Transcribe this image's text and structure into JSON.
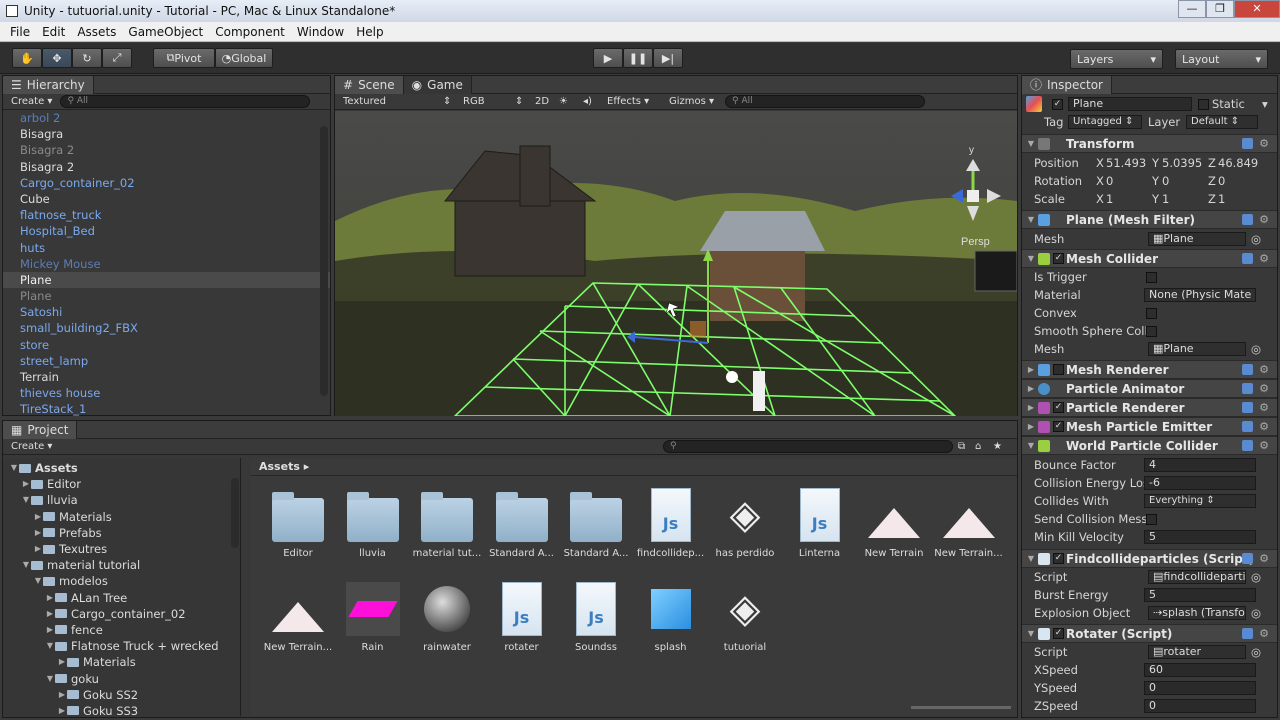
{
  "window": {
    "title": "Unity - tutuorial.unity - Tutorial - PC, Mac & Linux Standalone*",
    "min": "—",
    "max": "❐",
    "close": "✕"
  },
  "menu": [
    "File",
    "Edit",
    "Assets",
    "GameObject",
    "Component",
    "Window",
    "Help"
  ],
  "toolbar": {
    "pivot": "Pivot",
    "global": "Global",
    "layers": "Layers",
    "layout": "Layout"
  },
  "hierarchy": {
    "tab": "Hierarchy",
    "create": "Create",
    "search": "All",
    "items": [
      {
        "label": "arbol 2",
        "style": "dimblue"
      },
      {
        "label": "Bisagra",
        "style": "normal"
      },
      {
        "label": "Bisagra 2",
        "style": "dim"
      },
      {
        "label": "Bisagra 2",
        "style": "normal"
      },
      {
        "label": "Cargo_container_02",
        "style": "prefab"
      },
      {
        "label": "Cube",
        "style": "normal"
      },
      {
        "label": "flatnose_truck",
        "style": "prefab"
      },
      {
        "label": "Hospital_Bed",
        "style": "prefab"
      },
      {
        "label": "huts",
        "style": "prefab"
      },
      {
        "label": "Mickey Mouse",
        "style": "dimblue"
      },
      {
        "label": "Plane",
        "style": "sel"
      },
      {
        "label": "Plane",
        "style": "dim"
      },
      {
        "label": "Satoshi",
        "style": "prefab"
      },
      {
        "label": "small_building2_FBX",
        "style": "prefab"
      },
      {
        "label": "store",
        "style": "prefab"
      },
      {
        "label": "street_lamp",
        "style": "prefab"
      },
      {
        "label": "Terrain",
        "style": "normal"
      },
      {
        "label": "thieves house",
        "style": "prefab"
      },
      {
        "label": "TireStack_1",
        "style": "prefab"
      }
    ]
  },
  "scene": {
    "tab_scene": "Scene",
    "tab_game": "Game",
    "shading": "Textured",
    "render": "RGB",
    "mode2d": "2D",
    "effects": "Effects",
    "gizmos": "Gizmos",
    "search": "All",
    "persp": "Persp",
    "axis_y": "y"
  },
  "project": {
    "tab": "Project",
    "create": "Create",
    "breadcrumb": "Assets",
    "tree": [
      {
        "label": "Assets",
        "depth": 0,
        "open": true,
        "bold": true
      },
      {
        "label": "Editor",
        "depth": 1,
        "open": false
      },
      {
        "label": "lluvia",
        "depth": 1,
        "open": true
      },
      {
        "label": "Materials",
        "depth": 2,
        "open": false
      },
      {
        "label": "Prefabs",
        "depth": 2,
        "open": false
      },
      {
        "label": "Texutres",
        "depth": 2,
        "open": false
      },
      {
        "label": "material tutorial",
        "depth": 1,
        "open": true
      },
      {
        "label": "modelos",
        "depth": 2,
        "open": true
      },
      {
        "label": "ALan Tree",
        "depth": 3,
        "open": false
      },
      {
        "label": "Cargo_container_02",
        "depth": 3,
        "open": false
      },
      {
        "label": "fence",
        "depth": 3,
        "open": false
      },
      {
        "label": "Flatnose Truck + wrecked",
        "depth": 3,
        "open": true
      },
      {
        "label": "Materials",
        "depth": 4,
        "open": false
      },
      {
        "label": "goku",
        "depth": 3,
        "open": true
      },
      {
        "label": "Goku SS2",
        "depth": 4,
        "open": false
      },
      {
        "label": "Goku SS3",
        "depth": 4,
        "open": false
      }
    ],
    "assets_row1": [
      {
        "label": "Editor",
        "kind": "folder"
      },
      {
        "label": "lluvia",
        "kind": "folder"
      },
      {
        "label": "material tut...",
        "kind": "folder"
      },
      {
        "label": "Standard A...",
        "kind": "folder"
      },
      {
        "label": "Standard A...",
        "kind": "folder"
      },
      {
        "label": "findcollidep...",
        "kind": "js"
      },
      {
        "label": "has perdido",
        "kind": "unity"
      },
      {
        "label": "Linterna",
        "kind": "js"
      },
      {
        "label": "New Terrain",
        "kind": "terrain"
      },
      {
        "label": "New Terrain...",
        "kind": "terrain"
      }
    ],
    "assets_row2": [
      {
        "label": "New Terrain...",
        "kind": "terrain"
      },
      {
        "label": "Rain",
        "kind": "material-pink"
      },
      {
        "label": "rainwater",
        "kind": "sphere"
      },
      {
        "label": "rotater",
        "kind": "js"
      },
      {
        "label": "Soundss",
        "kind": "js"
      },
      {
        "label": "splash",
        "kind": "cube"
      },
      {
        "label": "tutuorial",
        "kind": "unity"
      }
    ]
  },
  "inspector": {
    "tab": "Inspector",
    "object_name": "Plane",
    "static": "Static",
    "tag_label": "Tag",
    "tag_value": "Untagged",
    "layer_label": "Layer",
    "layer_value": "Default",
    "transform": {
      "title": "Transform",
      "position": {
        "label": "Position",
        "x": "51.493",
        "y": "5.0395",
        "z": "46.849"
      },
      "rotation": {
        "label": "Rotation",
        "x": "0",
        "y": "0",
        "z": "0"
      },
      "scale": {
        "label": "Scale",
        "x": "1",
        "y": "1",
        "z": "1"
      }
    },
    "mesh_filter": {
      "title": "Plane (Mesh Filter)",
      "mesh_label": "Mesh",
      "mesh_value": "Plane"
    },
    "mesh_collider": {
      "title": "Mesh Collider",
      "is_trigger": "Is Trigger",
      "material": "Material",
      "material_value": "None (Physic Mate",
      "convex": "Convex",
      "smooth": "Smooth Sphere Colli",
      "mesh_label": "Mesh",
      "mesh_value": "Plane"
    },
    "collapsed": [
      "Mesh Renderer",
      "Particle Animator",
      "Particle Renderer",
      "Mesh Particle Emitter"
    ],
    "world_particle_collider": {
      "title": "World Particle Collider",
      "bounce": {
        "label": "Bounce Factor",
        "value": "4"
      },
      "energy_loss": {
        "label": "Collision Energy Los:",
        "value": "-6"
      },
      "collides_with": {
        "label": "Collides With",
        "value": "Everything"
      },
      "send_msg": {
        "label": "Send Collision Messa"
      },
      "min_kill": {
        "label": "Min Kill Velocity",
        "value": "5"
      }
    },
    "findcollide": {
      "title": "Findcollideparticles (Script)",
      "script": "Script",
      "script_value": "findcollideparticl",
      "burst": "Burst Energy",
      "burst_value": "5",
      "explosion": "Explosion Object",
      "explosion_value": "splash (Transfo"
    },
    "rotater": {
      "title": "Rotater (Script)",
      "script": "Script",
      "script_value": "rotater",
      "xs": "XSpeed",
      "xs_v": "60",
      "ys": "YSpeed",
      "ys_v": "0",
      "zs": "ZSpeed",
      "zs_v": "0"
    }
  }
}
